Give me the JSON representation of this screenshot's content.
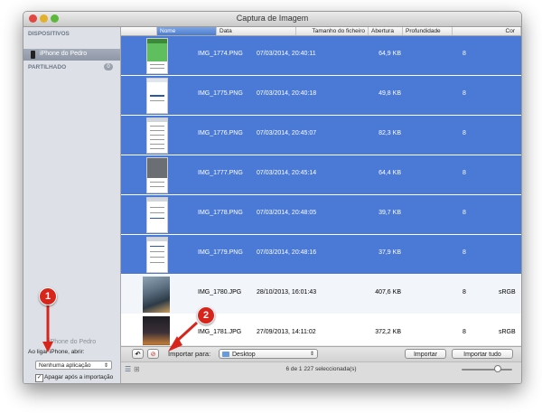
{
  "window": {
    "title": "Captura de Imagem"
  },
  "sidebar": {
    "devices_header": "DISPOSITIVOS",
    "device_name": "iPhone do Pedro",
    "shared_header": "PARTILHADO",
    "shared_count": "0",
    "device_panel_title": "iPhone do Pedro",
    "open_label": "Ao ligar iPhone, abrir:",
    "open_value": "Nenhuma aplicação",
    "delete_after_import_label": "Apagar após a importação",
    "delete_after_import_checked": true
  },
  "columns": [
    "Nome",
    "Data",
    "Tamanho do ficheiro",
    "Abertura",
    "Profundidade",
    "Cor"
  ],
  "rows": [
    {
      "name": "IMG_1774.PNG",
      "date": "07/03/2014, 20:40:11",
      "size": "64,9 KB",
      "aperture": "",
      "depth": "8",
      "color": "",
      "selected": true
    },
    {
      "name": "IMG_1775.PNG",
      "date": "07/03/2014, 20:40:18",
      "size": "49,8 KB",
      "aperture": "",
      "depth": "8",
      "color": "",
      "selected": true
    },
    {
      "name": "IMG_1776.PNG",
      "date": "07/03/2014, 20:45:07",
      "size": "82,3 KB",
      "aperture": "",
      "depth": "8",
      "color": "",
      "selected": true
    },
    {
      "name": "IMG_1777.PNG",
      "date": "07/03/2014, 20:45:14",
      "size": "64,4 KB",
      "aperture": "",
      "depth": "8",
      "color": "",
      "selected": true
    },
    {
      "name": "IMG_1778.PNG",
      "date": "07/03/2014, 20:48:05",
      "size": "39,7 KB",
      "aperture": "",
      "depth": "8",
      "color": "",
      "selected": true
    },
    {
      "name": "IMG_1779.PNG",
      "date": "07/03/2014, 20:48:16",
      "size": "37,9 KB",
      "aperture": "",
      "depth": "8",
      "color": "",
      "selected": true
    },
    {
      "name": "IMG_1780.JPG",
      "date": "28/10/2013, 16:01:43",
      "size": "407,6 KB",
      "aperture": "",
      "depth": "8",
      "color": "sRGB",
      "selected": false
    },
    {
      "name": "IMG_1781.JPG",
      "date": "27/09/2013, 14:11:02",
      "size": "372,2 KB",
      "aperture": "",
      "depth": "8",
      "color": "sRGB",
      "selected": false
    }
  ],
  "toolbar": {
    "rotate_icon": "rotate-left-icon",
    "delete_icon": "no-entry-icon",
    "import_to_label": "Importar para:",
    "destination": "Desktop",
    "import_label": "Importar",
    "import_all_label": "Importar tudo"
  },
  "status": {
    "selection_text": "6 de 1 227 seleccionada(s)",
    "zoom_level": 0.75
  },
  "annotations": [
    "1",
    "2"
  ],
  "colors": {
    "selection": "#4a79d6",
    "callout": "#d8251c"
  }
}
